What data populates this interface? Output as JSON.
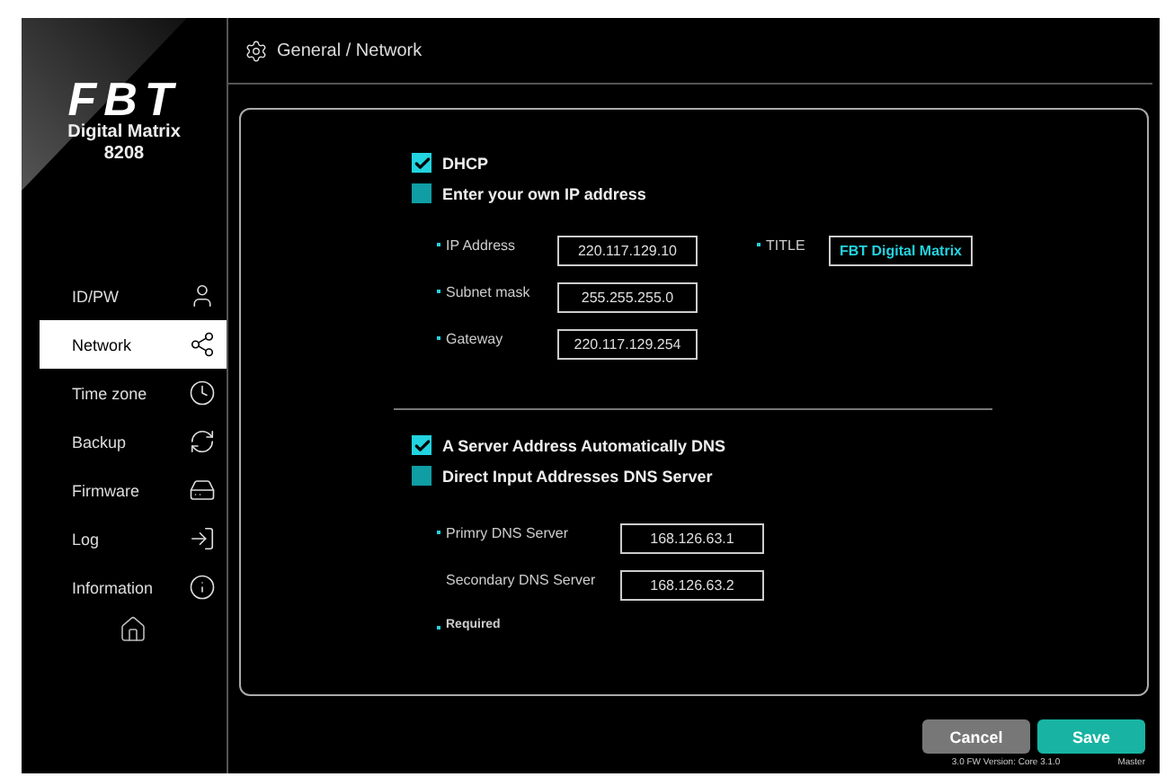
{
  "logo": {
    "brand": "FBT",
    "product": "Digital Matrix",
    "model": "8208"
  },
  "sidebar": {
    "items": [
      {
        "label": "ID/PW",
        "kind": "user",
        "selected": false
      },
      {
        "label": "Network",
        "kind": "network",
        "selected": true
      },
      {
        "label": "Time zone",
        "kind": "clock",
        "selected": false
      },
      {
        "label": "Backup",
        "kind": "backup",
        "selected": false
      },
      {
        "label": "Firmware",
        "kind": "firmware",
        "selected": false
      },
      {
        "label": "Log",
        "kind": "log",
        "selected": false
      },
      {
        "label": "Information",
        "kind": "info",
        "selected": false
      }
    ]
  },
  "breadcrumb": "General / Network",
  "ip_section": {
    "options": [
      {
        "label": "DHCP",
        "checked": true
      },
      {
        "label": "Enter your own IP address",
        "checked": false
      }
    ],
    "fields": [
      {
        "label": "IP Address",
        "value": "220.117.129.10",
        "required": true
      },
      {
        "label": "Subnet mask",
        "value": "255.255.255.0",
        "required": true
      },
      {
        "label": "Gateway",
        "value": "220.117.129.254",
        "required": true
      }
    ],
    "title_field": {
      "label": "TITLE",
      "value": "FBT Digital Matrix",
      "required": true
    }
  },
  "dns_section": {
    "options": [
      {
        "label": "A Server Address Automatically DNS",
        "checked": true
      },
      {
        "label": "Direct Input Addresses DNS Server",
        "checked": false
      }
    ],
    "fields": [
      {
        "label": "Primry DNS Server",
        "value": "168.126.63.1",
        "required": true
      },
      {
        "label": "Secondary DNS Server",
        "value": "168.126.63.2",
        "required": false
      }
    ],
    "note": "Required"
  },
  "buttons": [
    {
      "label": "Cancel",
      "kind": "secondary"
    },
    {
      "label": "Save",
      "kind": "primary"
    }
  ],
  "footer": {
    "version": "3.0 FW Version: Core 3.1.0",
    "role": "Master"
  }
}
